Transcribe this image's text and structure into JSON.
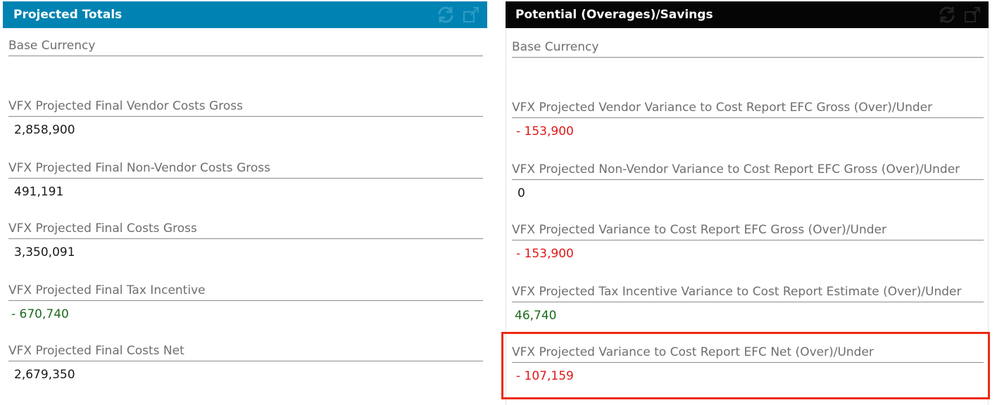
{
  "left_panel": {
    "title": "Projected Totals",
    "fields": [
      {
        "label": "Base Currency",
        "value": ""
      },
      {
        "label": "VFX Projected Final Vendor Costs Gross",
        "value": "2,858,900"
      },
      {
        "label": "VFX Projected Final Non-Vendor Costs Gross",
        "value": "491,191"
      },
      {
        "label": "VFX Projected Final Costs Gross",
        "value": "3,350,091"
      },
      {
        "label": "VFX Projected Final Tax Incentive",
        "value": "- 670,740"
      },
      {
        "label": "VFX Projected Final Costs Net",
        "value": "2,679,350"
      }
    ]
  },
  "right_panel": {
    "title": "Potential (Overages)/Savings",
    "fields": [
      {
        "label": "Base Currency",
        "value": ""
      },
      {
        "label": "VFX Projected Vendor Variance to Cost Report EFC Gross (Over)/Under",
        "value": "- 153,900"
      },
      {
        "label": "VFX Projected Non-Vendor Variance to Cost Report EFC Gross (Over)/Under",
        "value": "0"
      },
      {
        "label": "VFX Projected Variance to Cost Report EFC Gross (Over)/Under",
        "value": "- 153,900"
      },
      {
        "label": "VFX Projected Tax Incentive Variance to Cost Report Estimate (Over)/Under",
        "value": "46,740"
      },
      {
        "label": "VFX Projected Variance to Cost Report EFC Net (Over)/Under",
        "value": "- 107,159"
      }
    ]
  },
  "icons": {
    "refresh": "refresh-icon",
    "popout": "popout-icon"
  },
  "colors": {
    "left_header": "#0083b3",
    "right_header": "#050505",
    "negative": "#e01818",
    "positive_green": "#1d6b1d",
    "highlight": "#ee2a14"
  }
}
